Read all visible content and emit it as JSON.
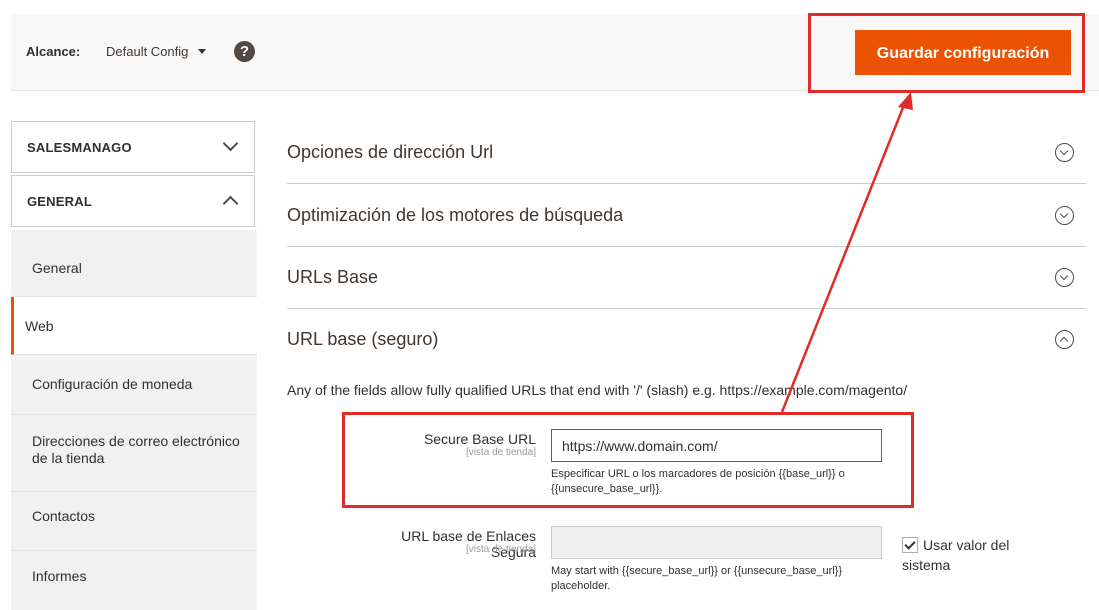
{
  "scope": {
    "label": "Alcance:",
    "value": "Default Config",
    "help_glyph": "?"
  },
  "toolbar": {
    "save_label": "Guardar configuración"
  },
  "sidebar": {
    "sections": [
      {
        "title": "SALESMANAGO",
        "expanded": false
      },
      {
        "title": "GENERAL",
        "expanded": true
      }
    ],
    "items": [
      {
        "label": "General",
        "active": false
      },
      {
        "label": "Web",
        "active": true
      },
      {
        "label": "Configuración de moneda",
        "active": false
      },
      {
        "label": "Direcciones de correo electrónico de la tienda",
        "active": false
      },
      {
        "label": "Contactos",
        "active": false
      },
      {
        "label": "Informes",
        "active": false
      }
    ]
  },
  "sections": [
    {
      "title": "Opciones de dirección Url",
      "expanded": false
    },
    {
      "title": "Optimización de los motores de búsqueda",
      "expanded": false
    },
    {
      "title": "URLs Base",
      "expanded": false
    },
    {
      "title": "URL base (seguro)",
      "expanded": true
    }
  ],
  "secure_section": {
    "note": "Any of the fields allow fully qualified URLs that end with '/' (slash) e.g. https://example.com/magento/",
    "fields": [
      {
        "label": "Secure Base URL",
        "scope": "[vista de tienda]",
        "value": "https://www.domain.com/",
        "note": "Especificar URL o los marcadores de posición {{base_url}} o {{unsecure_base_url}}."
      },
      {
        "label": "URL base de Enlaces Segura",
        "scope": "[vista de tienda]",
        "value": "",
        "note": "May start with {{secure_base_url}} or {{unsecure_base_url}} placeholder.",
        "use_system_value": true,
        "use_system_label": "Usar valor del sistema"
      }
    ]
  },
  "colors": {
    "accent": "#eb5202",
    "annotation": "#e02b27"
  }
}
